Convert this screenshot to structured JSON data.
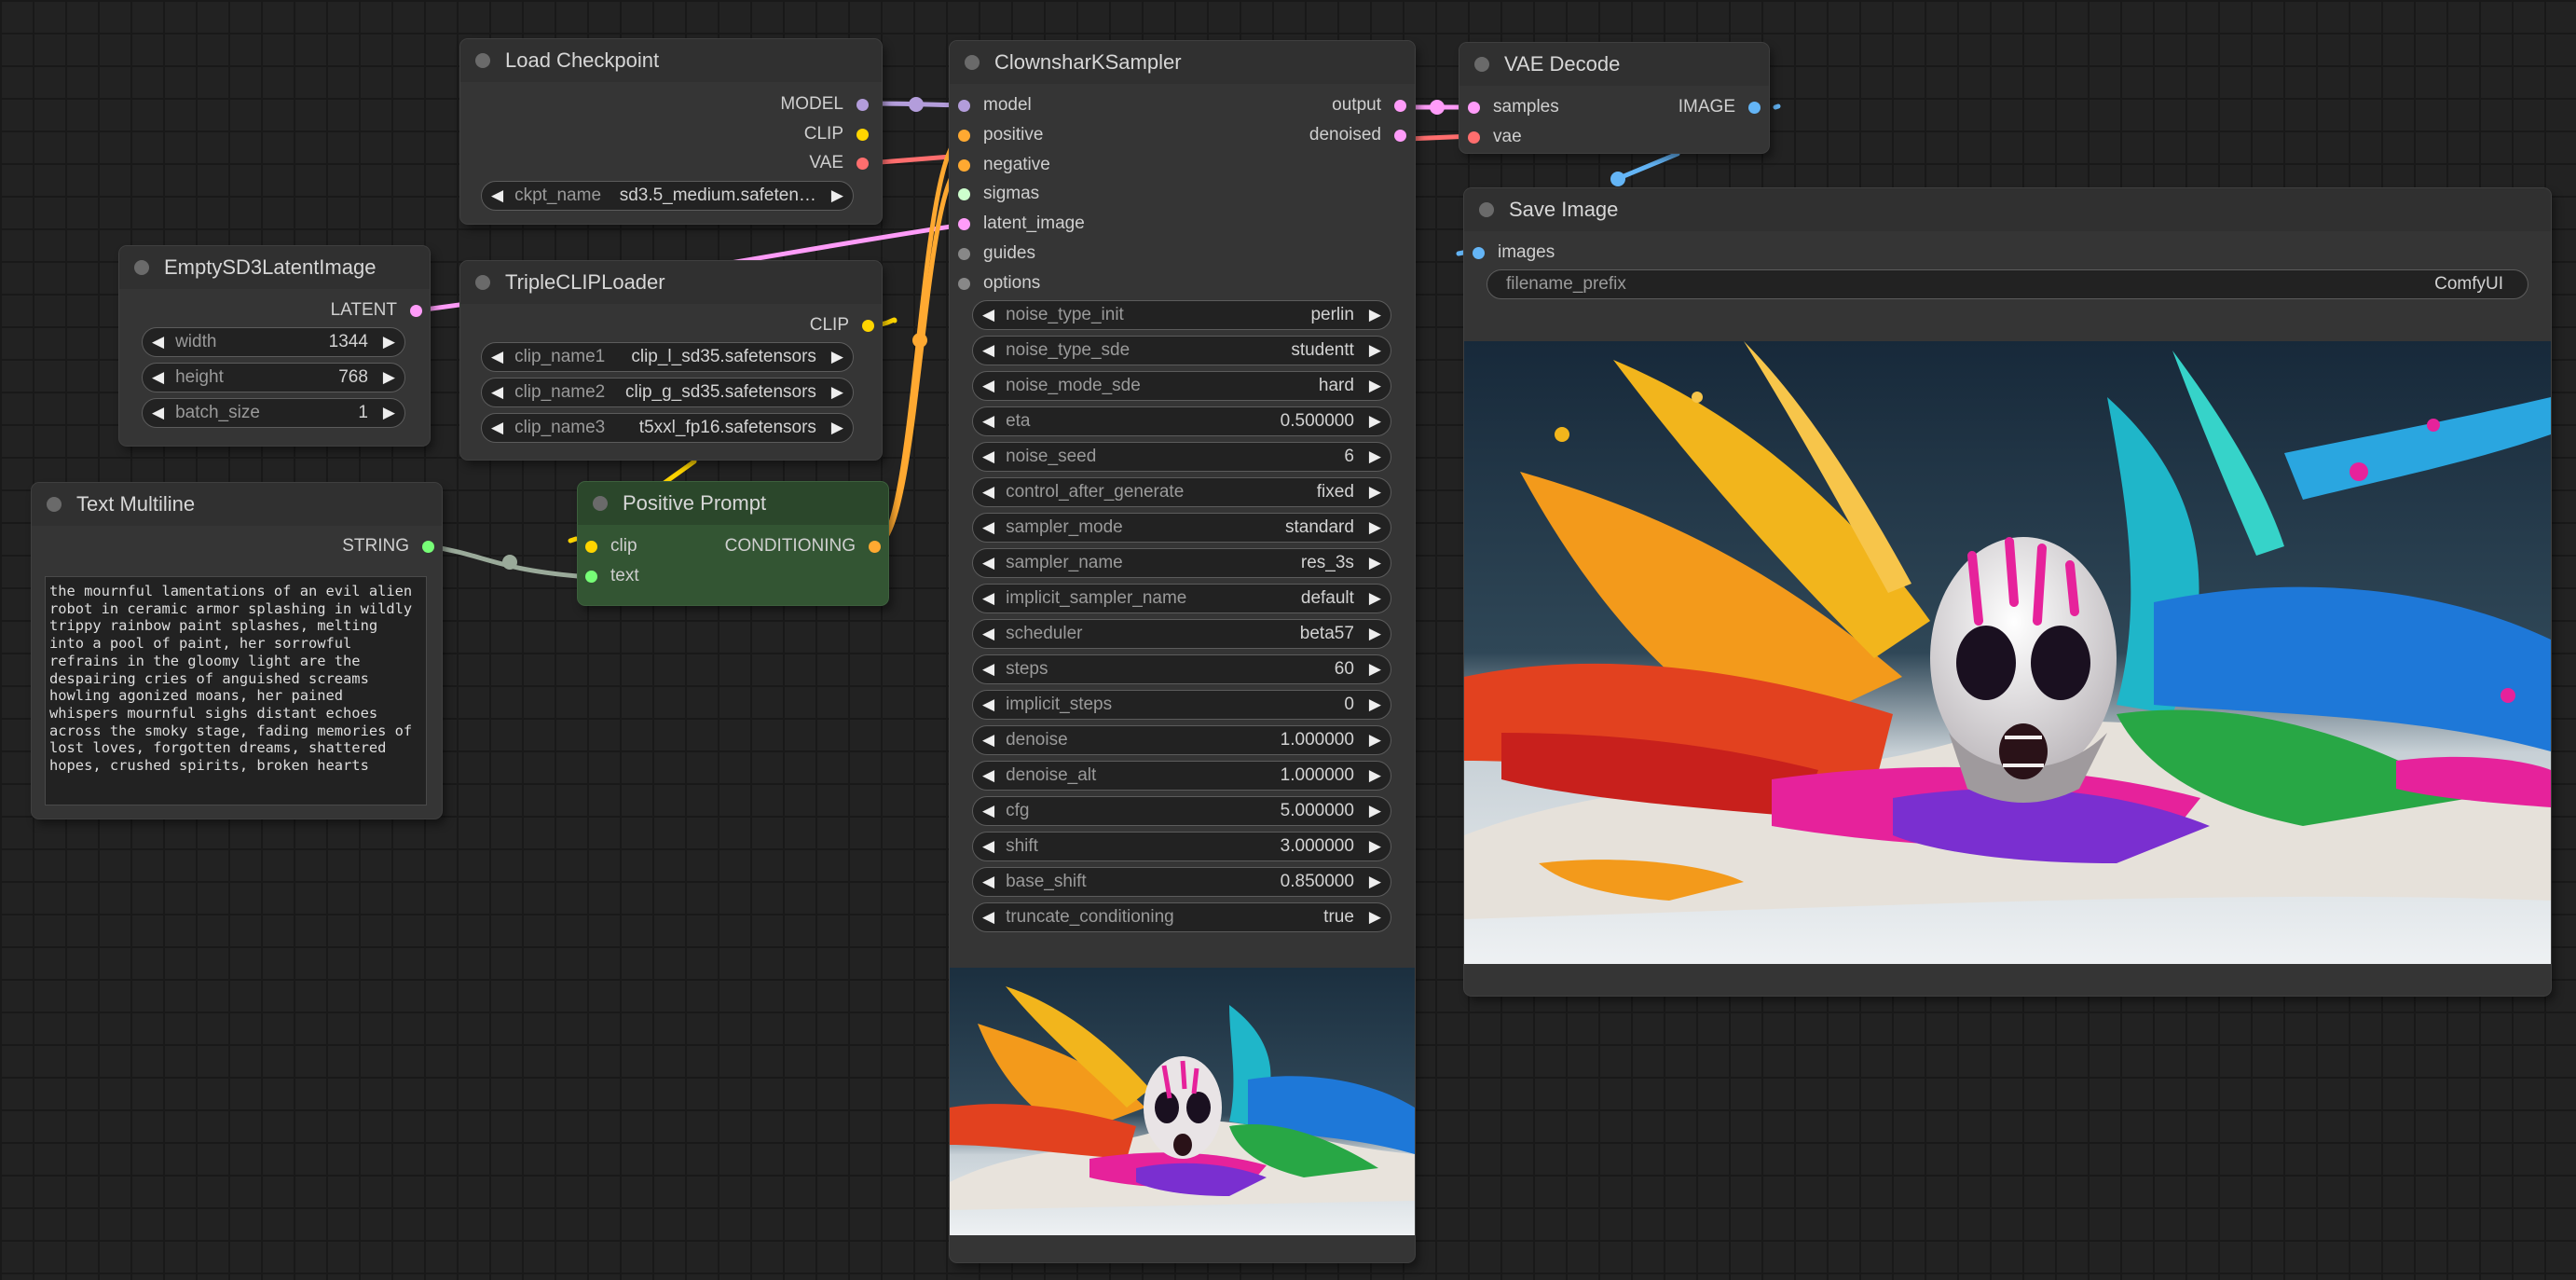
{
  "colors": {
    "model": "#b39ddb",
    "clip": "#ffd500",
    "vae": "#ff6e6e",
    "latent": "#ff9cf9",
    "image": "#64b5f6",
    "conditioning": "#ffa931",
    "string": "#77ff77",
    "sigmas": "#cdffcd",
    "guides": "#888888",
    "options": "#888888",
    "canvas_bg": "#222222",
    "node_bg": "#353535",
    "prompt_node_bg": "#335533"
  },
  "nodes": {
    "load_checkpoint": {
      "title": "Load Checkpoint",
      "outputs": [
        "MODEL",
        "CLIP",
        "VAE"
      ],
      "widgets": [
        {
          "name": "ckpt_name",
          "value": "sd3.5_medium.safeten…"
        }
      ]
    },
    "empty_latent": {
      "title": "EmptySD3LatentImage",
      "outputs": [
        "LATENT"
      ],
      "widgets": [
        {
          "name": "width",
          "value": "1344"
        },
        {
          "name": "height",
          "value": "768"
        },
        {
          "name": "batch_size",
          "value": "1"
        }
      ]
    },
    "triple_clip": {
      "title": "TripleCLIPLoader",
      "outputs": [
        "CLIP"
      ],
      "widgets": [
        {
          "name": "clip_name1",
          "value": "clip_l_sd35.safetensors"
        },
        {
          "name": "clip_name2",
          "value": "clip_g_sd35.safetensors"
        },
        {
          "name": "clip_name3",
          "value": "t5xxl_fp16.safetensors"
        }
      ]
    },
    "text_multiline": {
      "title": "Text Multiline",
      "outputs": [
        "STRING"
      ],
      "text": "the mournful lamentations of an evil alien\nrobot in ceramic armor splashing in wildly\ntrippy rainbow paint splashes, melting\ninto a pool of paint, her sorrowful\nrefrains in the gloomy light are the\ndespairing cries of anguished screams\nhowling agonized moans, her pained\nwhispers mournful sighs distant echoes\nacross the smoky stage, fading memories of\nlost loves, forgotten dreams, shattered\nhopes, crushed spirits, broken hearts"
    },
    "positive_prompt": {
      "title": "Positive Prompt",
      "inputs": [
        "clip",
        "text"
      ],
      "outputs": [
        "CONDITIONING"
      ]
    },
    "sampler": {
      "title": "ClownsharKSampler",
      "inputs": [
        "model",
        "positive",
        "negative",
        "sigmas",
        "latent_image",
        "guides",
        "options"
      ],
      "outputs": [
        "output",
        "denoised"
      ],
      "widgets": [
        {
          "name": "noise_type_init",
          "value": "perlin"
        },
        {
          "name": "noise_type_sde",
          "value": "studentt"
        },
        {
          "name": "noise_mode_sde",
          "value": "hard"
        },
        {
          "name": "eta",
          "value": "0.500000"
        },
        {
          "name": "noise_seed",
          "value": "6"
        },
        {
          "name": "control_after_generate",
          "value": "fixed"
        },
        {
          "name": "sampler_mode",
          "value": "standard"
        },
        {
          "name": "sampler_name",
          "value": "res_3s"
        },
        {
          "name": "implicit_sampler_name",
          "value": "default"
        },
        {
          "name": "scheduler",
          "value": "beta57"
        },
        {
          "name": "steps",
          "value": "60"
        },
        {
          "name": "implicit_steps",
          "value": "0"
        },
        {
          "name": "denoise",
          "value": "1.000000"
        },
        {
          "name": "denoise_alt",
          "value": "1.000000"
        },
        {
          "name": "cfg",
          "value": "5.000000"
        },
        {
          "name": "shift",
          "value": "3.000000"
        },
        {
          "name": "base_shift",
          "value": "0.850000"
        },
        {
          "name": "truncate_conditioning",
          "value": "true"
        }
      ]
    },
    "vae_decode": {
      "title": "VAE Decode",
      "inputs": [
        "samples",
        "vae"
      ],
      "outputs": [
        "IMAGE"
      ]
    },
    "save_image": {
      "title": "Save Image",
      "inputs": [
        "images"
      ],
      "widgets": [
        {
          "name": "filename_prefix",
          "value": "ComfyUI"
        }
      ]
    }
  }
}
